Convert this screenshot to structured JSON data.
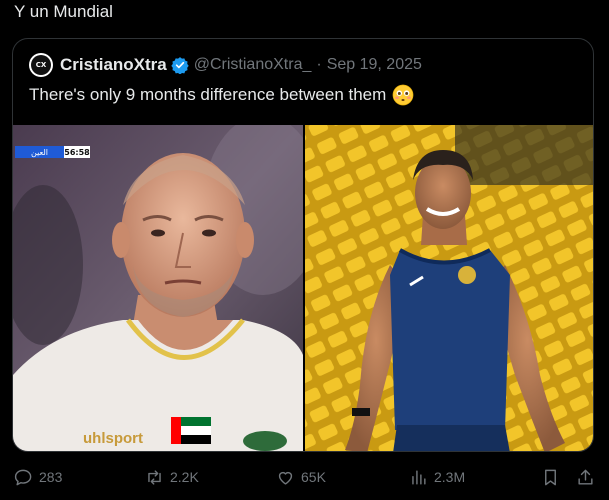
{
  "post": {
    "text": "Y un Mundial"
  },
  "quote": {
    "avatar_text": "CX",
    "author_name": "CristianoXtra",
    "handle": "@CristianoXtra_",
    "separator": "·",
    "date": "Sep 19, 2025",
    "text": "There's only 9 months difference between them",
    "images": {
      "left": {
        "score_team": "العين",
        "score_time": "56:58",
        "kit_sponsor": "uhlsport"
      }
    }
  },
  "actions": {
    "replies": "283",
    "reposts": "2.2K",
    "likes": "65K",
    "views": "2.3M"
  },
  "colors": {
    "background": "#000000",
    "text": "#e7e9ea",
    "secondary": "#71767b",
    "border": "#2f3336",
    "verified": "#1d9bf0"
  }
}
